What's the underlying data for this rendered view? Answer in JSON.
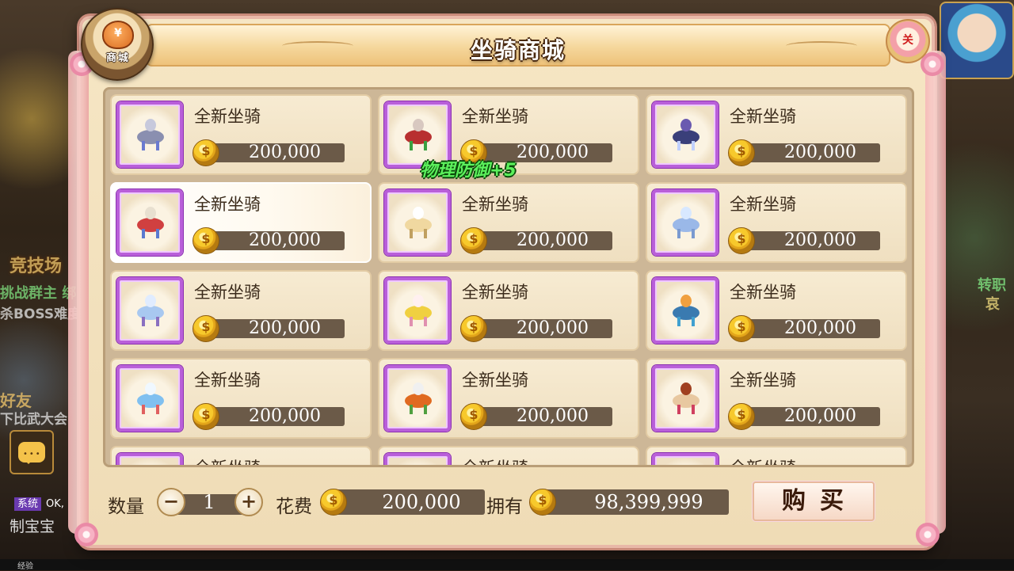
{
  "background": {
    "arena_label": "竞技场",
    "line1": "挑战群主 绑",
    "line2": "杀BOSS难度",
    "line3": "好友",
    "line4": "下比武大会",
    "system_tag": "系统",
    "system_text": "OK,",
    "chat_snippet": "制宝宝",
    "right1": "转职",
    "right2": "哀",
    "exp_label": "经验"
  },
  "shop": {
    "title": "坐骑商城",
    "badge_label": "商城",
    "badge_glyph": "¥",
    "close_label": "关",
    "floating_buff": "物理防御+5",
    "items": [
      {
        "name": "全新坐骑",
        "price": "200,000",
        "body": "#8a8fb0",
        "head": "#c7c9dc",
        "accent": "#6a7ad0"
      },
      {
        "name": "全新坐骑",
        "price": "200,000",
        "body": "#b83030",
        "head": "#d8c8c0",
        "accent": "#3aa040"
      },
      {
        "name": "全新坐骑",
        "price": "200,000",
        "body": "#3a3f7a",
        "head": "#6a5ab0",
        "accent": "#c0d0ff"
      },
      {
        "name": "全新坐骑",
        "price": "200,000",
        "body": "#d04040",
        "head": "#e8e0d0",
        "accent": "#5a7ad0"
      },
      {
        "name": "全新坐骑",
        "price": "200,000",
        "body": "#f0d8a0",
        "head": "#ffffff",
        "accent": "#c0a060"
      },
      {
        "name": "全新坐骑",
        "price": "200,000",
        "body": "#9ab8e8",
        "head": "#d8e8ff",
        "accent": "#7a9ad0"
      },
      {
        "name": "全新坐骑",
        "price": "200,000",
        "body": "#a8c8f0",
        "head": "#e0ecff",
        "accent": "#8a70c0"
      },
      {
        "name": "全新坐骑",
        "price": "200,000",
        "body": "#f0d040",
        "head": "#fff0f0",
        "accent": "#e090b0"
      },
      {
        "name": "全新坐骑",
        "price": "200,000",
        "body": "#3a7ab0",
        "head": "#f0a040",
        "accent": "#40a0d0"
      },
      {
        "name": "全新坐骑",
        "price": "200,000",
        "body": "#80c0f0",
        "head": "#f0f8ff",
        "accent": "#e06060"
      },
      {
        "name": "全新坐骑",
        "price": "200,000",
        "body": "#e06a20",
        "head": "#f0f0f0",
        "accent": "#50a040"
      },
      {
        "name": "全新坐骑",
        "price": "200,000",
        "body": "#e8c8a0",
        "head": "#a04020",
        "accent": "#d04060"
      },
      {
        "name": "全新坐骑",
        "price": "",
        "body": "#a0a0c0",
        "head": "#c0c0d0",
        "accent": "#8080a0"
      },
      {
        "name": "全新坐骑",
        "price": "",
        "body": "#a0a0c0",
        "head": "#c0c0d0",
        "accent": "#8080a0"
      },
      {
        "name": "全新坐骑",
        "price": "",
        "body": "#a0a0c0",
        "head": "#c0c0d0",
        "accent": "#8080a0"
      }
    ],
    "selected_index": 3
  },
  "purchase": {
    "quantity_label": "数量",
    "quantity_value": "1",
    "minus_symbol": "−",
    "plus_symbol": "+",
    "cost_label": "花费",
    "cost_value": "200,000",
    "owned_label": "拥有",
    "owned_value": "98,399,999",
    "buy_label": "购买"
  },
  "colors": {
    "frame_border": "#b95fd9",
    "price_bar": "#6b5a48",
    "title_text_outline": "#4a2a10",
    "buff_green": "#5cf05c"
  }
}
